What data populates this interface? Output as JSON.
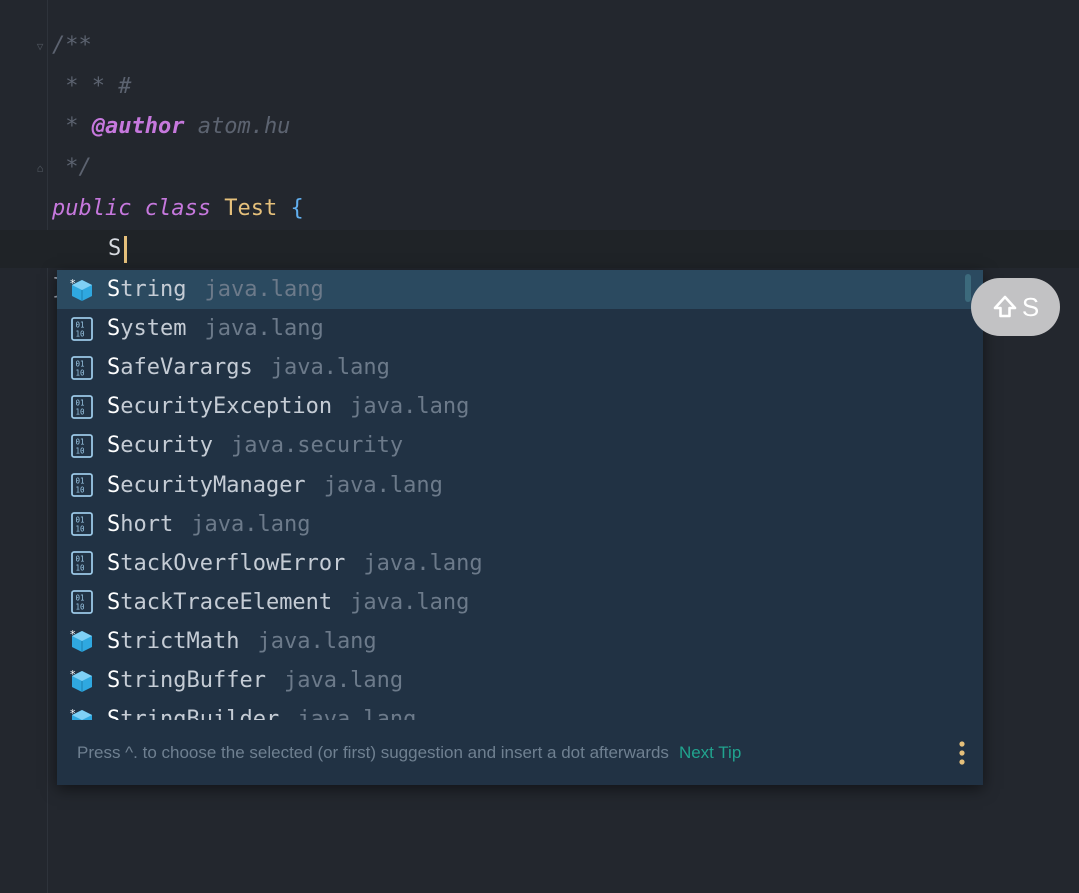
{
  "editor": {
    "doc_open": "/**",
    "doc_line2": " * * #",
    "doc_line3_star": " * ",
    "doc_author_tag": "@author",
    "doc_author_value": " atom.hu",
    "doc_close": " */",
    "kw_public": "public",
    "kw_class": "class",
    "class_name": "Test",
    "open_brace": "{",
    "typed_text": "S",
    "stray_close": "}"
  },
  "completion": {
    "items": [
      {
        "match": "S",
        "rest": "tring",
        "package": "java.lang",
        "icon": "class-icon",
        "selected": true
      },
      {
        "match": "S",
        "rest": "ystem",
        "package": "java.lang",
        "icon": "binary-class-icon"
      },
      {
        "match": "S",
        "rest": "afeVarargs",
        "package": "java.lang",
        "icon": "binary-class-icon"
      },
      {
        "match": "S",
        "rest": "ecurityException",
        "package": "java.lang",
        "icon": "binary-class-icon"
      },
      {
        "match": "S",
        "rest": "ecurity",
        "package": "java.security",
        "icon": "binary-class-icon"
      },
      {
        "match": "S",
        "rest": "ecurityManager",
        "package": "java.lang",
        "icon": "binary-class-icon"
      },
      {
        "match": "S",
        "rest": "hort",
        "package": "java.lang",
        "icon": "binary-class-icon"
      },
      {
        "match": "S",
        "rest": "tackOverflowError",
        "package": "java.lang",
        "icon": "binary-class-icon"
      },
      {
        "match": "S",
        "rest": "tackTraceElement",
        "package": "java.lang",
        "icon": "binary-class-icon"
      },
      {
        "match": "S",
        "rest": "trictMath",
        "package": "java.lang",
        "icon": "class-icon"
      },
      {
        "match": "S",
        "rest": "tringBuffer",
        "package": "java.lang",
        "icon": "class-icon"
      },
      {
        "match": "S",
        "rest": "tringBuilder",
        "package": "java.lang",
        "icon": "class-icon"
      }
    ],
    "tip_text": "Press ^. to choose the selected (or first) suggestion and insert a dot afterwards",
    "tip_link": "Next Tip"
  },
  "key_hint": {
    "label": "S",
    "icon": "shift-icon"
  },
  "colors": {
    "accent_link": "#21a38e",
    "popup_bg": "#213244",
    "selected_bg": "#2b4a60",
    "caret": "#e5c07b",
    "class_icon": "#2fa8e0"
  }
}
